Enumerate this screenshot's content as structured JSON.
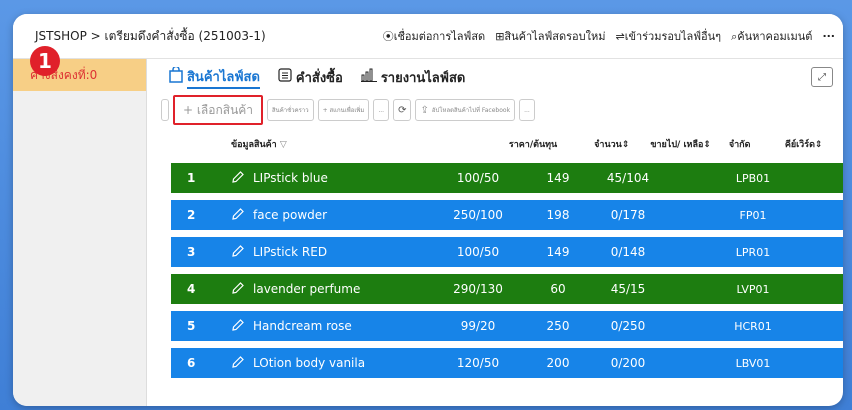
{
  "window": {
    "title": "JSTSHOP > เตรียมดึงคำสั่งซื้อ (251003-1)",
    "links": [
      {
        "icon": "play-circle-icon",
        "label": "เชื่อมต่อการไลฟ์สด"
      },
      {
        "icon": "plus-square-icon",
        "label": "สินค้าไลฟ์สดรอบใหม่"
      },
      {
        "icon": "swap-arrows-icon",
        "label": "เข้าร่วมรอบไลฟ์อื่นๆ"
      },
      {
        "icon": "search-icon",
        "label": "ค้นหาคอมเมนต์"
      }
    ],
    "more": "..."
  },
  "sidebar": {
    "pending_label": "ค้างส่งคงที่:0"
  },
  "tabs": [
    {
      "icon": "bag-icon",
      "label": "สินค้าไลฟ์สด",
      "active": true
    },
    {
      "icon": "list-icon",
      "label": "คำสั่งซื้อ",
      "active": false
    },
    {
      "icon": "bar-chart-icon",
      "label": "รายงานไลฟ์สด",
      "active": false
    }
  ],
  "toolbar": {
    "select_product": "+ เลือกสินค้า",
    "btn2": "สินค้าชั่วคราว",
    "btn3": "+ สแกนเพื่อเพิ่ม",
    "btn4": "...",
    "upload": "อัปโหลดสินค้าไปที่ Facebook",
    "btn6": "..."
  },
  "step_badge": "1",
  "table": {
    "headers": {
      "product": "ข้อมูลสินค้า",
      "price": "ราคา/ต้นทุน",
      "qty": "จำนวน",
      "sold": "ขายไป/ เหลือ",
      "limit": "จำกัด",
      "keyword": "คีย์เวิร์ด"
    },
    "rows": [
      {
        "num": "1",
        "name": "LIPstick blue",
        "price": "100/50",
        "qty": "149",
        "sold": "45/104",
        "limit": "",
        "key": "LPB01",
        "color": "green"
      },
      {
        "num": "2",
        "name": "face powder",
        "price": "250/100",
        "qty": "198",
        "sold": "0/178",
        "limit": "",
        "key": "FP01",
        "color": "blue"
      },
      {
        "num": "3",
        "name": "LIPstick RED",
        "price": "100/50",
        "qty": "149",
        "sold": "0/148",
        "limit": "",
        "key": "LPR01",
        "color": "blue"
      },
      {
        "num": "4",
        "name": "lavender perfume",
        "price": "290/130",
        "qty": "60",
        "sold": "45/15",
        "limit": "",
        "key": "LVP01",
        "color": "green"
      },
      {
        "num": "5",
        "name": "Handcream rose",
        "price": "99/20",
        "qty": "250",
        "sold": "0/250",
        "limit": "",
        "key": "HCR01",
        "color": "blue"
      },
      {
        "num": "6",
        "name": "LOtion body vanila",
        "price": "120/50",
        "qty": "200",
        "sold": "0/200",
        "limit": "",
        "key": "LBV01",
        "color": "blue"
      }
    ]
  },
  "colors": {
    "green_row": "#1d7d10",
    "blue_row": "#1784e8",
    "accent": "#1976d2",
    "highlight": "#e0212a"
  }
}
